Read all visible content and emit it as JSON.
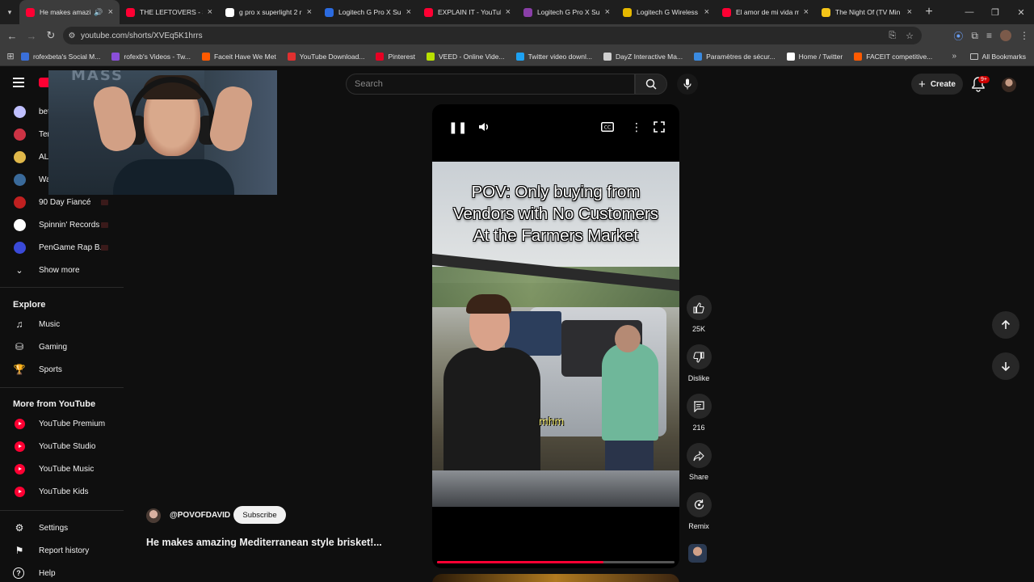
{
  "browser": {
    "tabs": [
      {
        "title": "He makes amazin",
        "favicon_color": "#ff0033",
        "active": true,
        "audio": true
      },
      {
        "title": "THE LEFTOVERS - Sea",
        "favicon_color": "#ff0033"
      },
      {
        "title": "g pro x superlight 2 r",
        "favicon_color": "#ffffff"
      },
      {
        "title": "Logitech G Pro X Sup",
        "favicon_color": "#2b6be0"
      },
      {
        "title": "EXPLAIN IT - YouTub",
        "favicon_color": "#ff0033"
      },
      {
        "title": "Logitech G Pro X Sup",
        "favicon_color": "#8a3fa8"
      },
      {
        "title": "Logitech G Wireless",
        "favicon_color": "#e6b800"
      },
      {
        "title": "El amor de mi vida m",
        "favicon_color": "#ff0033"
      },
      {
        "title": "The Night Of (TV Min",
        "favicon_color": "#f5c518"
      }
    ],
    "url": "youtube.com/shorts/XVEq5K1hrrs",
    "bookmarks": [
      {
        "label": "rofexbeta's Social M...",
        "color": "#3a6fd8"
      },
      {
        "label": "rofexb's Videos - Tw...",
        "color": "#8a4fd8"
      },
      {
        "label": "Faceit Have We Met",
        "color": "#ff5a00"
      },
      {
        "label": "YouTube Download...",
        "color": "#e03030"
      },
      {
        "label": "Pinterest",
        "color": "#e60023"
      },
      {
        "label": "VEED - Online Vide...",
        "color": "#b8e000"
      },
      {
        "label": "Twitter video downl...",
        "color": "#1da1f2"
      },
      {
        "label": "DayZ Interactive Ma...",
        "color": "#cfcfcf"
      },
      {
        "label": "Paramètres de sécur...",
        "color": "#3a8ae0"
      },
      {
        "label": "Home / Twitter",
        "color": "#ffffff"
      },
      {
        "label": "FACEIT competitive...",
        "color": "#ff5a00"
      }
    ],
    "all_bookmarks": "All Bookmarks"
  },
  "masthead": {
    "search_placeholder": "Search",
    "create_label": "Create",
    "notification_badge": "9+"
  },
  "sidebar": {
    "subscriptions": [
      {
        "label": "bet",
        "color": "#c0c0ff"
      },
      {
        "label": "Ter",
        "color": "#cc3344"
      },
      {
        "label": "ALJ",
        "color": "#e0b84a"
      },
      {
        "label": "Wa",
        "color": "#3a6a9a"
      },
      {
        "label": "90 Day Fiancé",
        "color": "#c02020"
      },
      {
        "label": "Spinnin' Records",
        "color": "#ffffff"
      },
      {
        "label": "PenGame Rap B...",
        "color": "#3a4ad8"
      }
    ],
    "show_more": "Show more",
    "explore_heading": "Explore",
    "explore": [
      {
        "label": "Music",
        "icon": "music-note-icon"
      },
      {
        "label": "Gaming",
        "icon": "gamepad-icon"
      },
      {
        "label": "Sports",
        "icon": "trophy-icon"
      }
    ],
    "more_heading": "More from YouTube",
    "more": [
      {
        "label": "YouTube Premium"
      },
      {
        "label": "YouTube Studio"
      },
      {
        "label": "YouTube Music"
      },
      {
        "label": "YouTube Kids"
      }
    ],
    "footer": [
      {
        "label": "Settings",
        "icon": "gear-icon"
      },
      {
        "label": "Report history",
        "icon": "flag-icon"
      },
      {
        "label": "Help",
        "icon": "help-icon"
      }
    ]
  },
  "short": {
    "caption_lines": [
      "POV: Only buying from",
      "Vendors with No Customers",
      "At the Farmers Market"
    ],
    "subtitle": "mhm",
    "progress": 0.7,
    "channel_handle": "@POVOFDAVID",
    "subscribe_label": "Subscribe",
    "title": "He makes amazing Mediterranean style brisket!..."
  },
  "actions": {
    "like_count": "25K",
    "dislike_label": "Dislike",
    "comment_count": "216",
    "share_label": "Share",
    "remix_label": "Remix"
  }
}
